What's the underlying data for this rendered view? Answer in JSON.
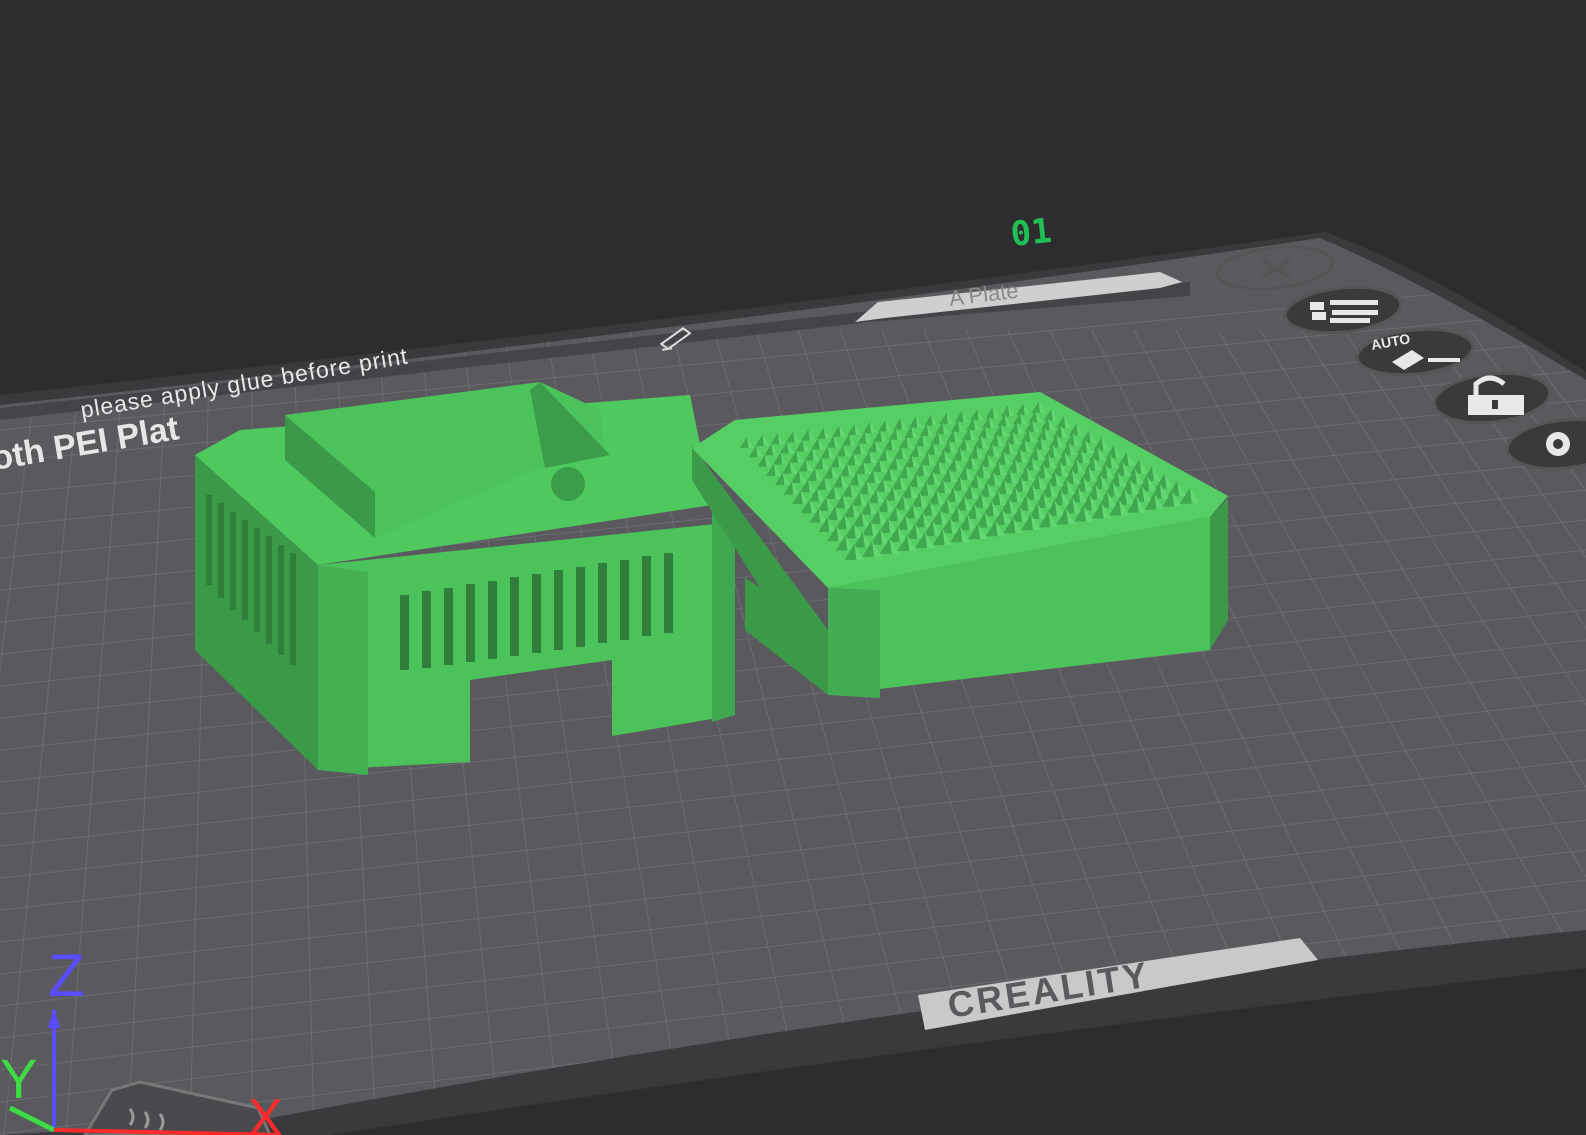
{
  "plate": {
    "index_label": "01",
    "name": "A Plate",
    "notice": "please apply glue before print",
    "bed_type_label": "oth PEI Plat",
    "brand": "CREALITY",
    "auto_label": "AUTO"
  },
  "axes": {
    "x": "X",
    "y": "Y",
    "z": "Z"
  },
  "toolbar": {
    "close_icon": "close-icon",
    "list_icon": "object-list-icon",
    "auto_arrange_icon": "auto-arrange-icon",
    "lock_icon": "lock-icon",
    "settings_icon": "gear-icon"
  },
  "colors": {
    "background": "#2d2d2f",
    "bed": "#5c5c60",
    "grid": "#6e6e72",
    "model": "#4dc25c",
    "model_dark": "#358b40",
    "accent": "#1fbf55",
    "axis_x": "#ff2a2a",
    "axis_y": "#3ddc44",
    "axis_z": "#5a4cff"
  }
}
